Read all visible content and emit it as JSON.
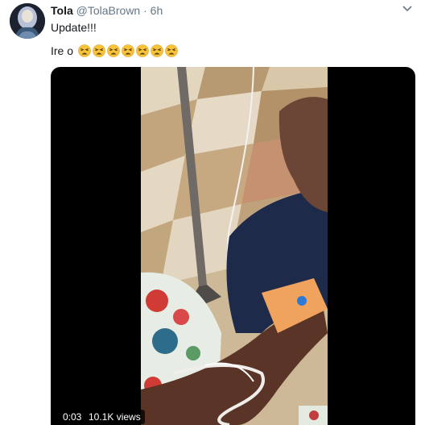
{
  "tweet": {
    "author_name": "Tola",
    "author_handle": "@TolaBrown",
    "separator": "·",
    "time_ago": "6h",
    "text": "Update!!!",
    "reply_text": "Ire o",
    "emoji_name": "weary-face-emoji",
    "emoji_count": 7
  },
  "video": {
    "elapsed": "0:03",
    "views": "10.1K views"
  },
  "colors": {
    "text": "#14171a",
    "muted": "#657786",
    "emoji_face": "#f6c33b",
    "video_bg": "#000000"
  }
}
